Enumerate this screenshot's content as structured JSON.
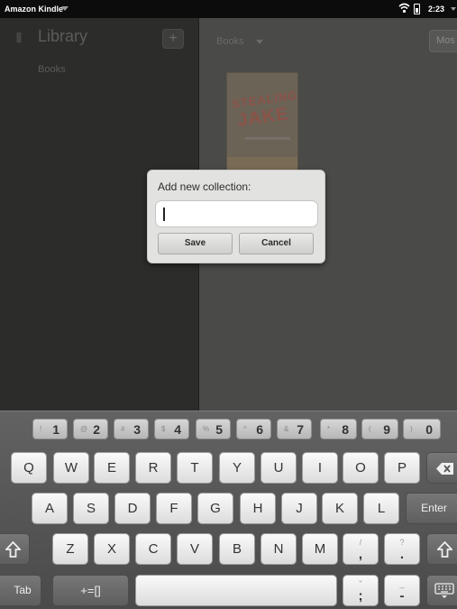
{
  "status_bar": {
    "app_name": "Amazon Kindle",
    "time": "2:23"
  },
  "sidebar": {
    "title": "Library",
    "add_label": "+",
    "items": [
      {
        "label": "Books"
      }
    ]
  },
  "main": {
    "filter_label": "Books",
    "sort_label": "Mos",
    "books": [
      {
        "cover_title_line1": "STEALING",
        "cover_title_line2": "JAKE"
      }
    ]
  },
  "dialog": {
    "title": "Add new collection:",
    "input_value": "",
    "save_label": "Save",
    "cancel_label": "Cancel"
  },
  "keyboard": {
    "number_row": [
      {
        "sym": "!",
        "num": "1"
      },
      {
        "sym": "@",
        "num": "2"
      },
      {
        "sym": "#",
        "num": "3"
      },
      {
        "sym": "$",
        "num": "4"
      },
      {
        "sym": "%",
        "num": "5"
      },
      {
        "sym": "^",
        "num": "6"
      },
      {
        "sym": "&",
        "num": "7"
      },
      {
        "sym": "*",
        "num": "8"
      },
      {
        "sym": "(",
        "num": "9"
      },
      {
        "sym": ")",
        "num": "0"
      }
    ],
    "row1": [
      "Q",
      "W",
      "E",
      "R",
      "T",
      "Y",
      "U",
      "I",
      "O",
      "P"
    ],
    "row2": [
      "A",
      "S",
      "D",
      "F",
      "G",
      "H",
      "J",
      "K",
      "L"
    ],
    "row3": [
      "Z",
      "X",
      "C",
      "V",
      "B",
      "N",
      "M"
    ],
    "enter_label": "Enter",
    "tab_label": "Tab",
    "symbols_label": "+=[]",
    "slash_key": {
      "top": "/",
      "bottom": ","
    },
    "question_key": {
      "top": "?",
      "bottom": "."
    },
    "quote_key": {
      "top": "\"",
      "bottom": ";"
    },
    "dash_key": {
      "top": "_",
      "bottom": "-"
    },
    "icons": [
      "backspace-icon",
      "shift-icon",
      "hide-keyboard-icon"
    ]
  }
}
